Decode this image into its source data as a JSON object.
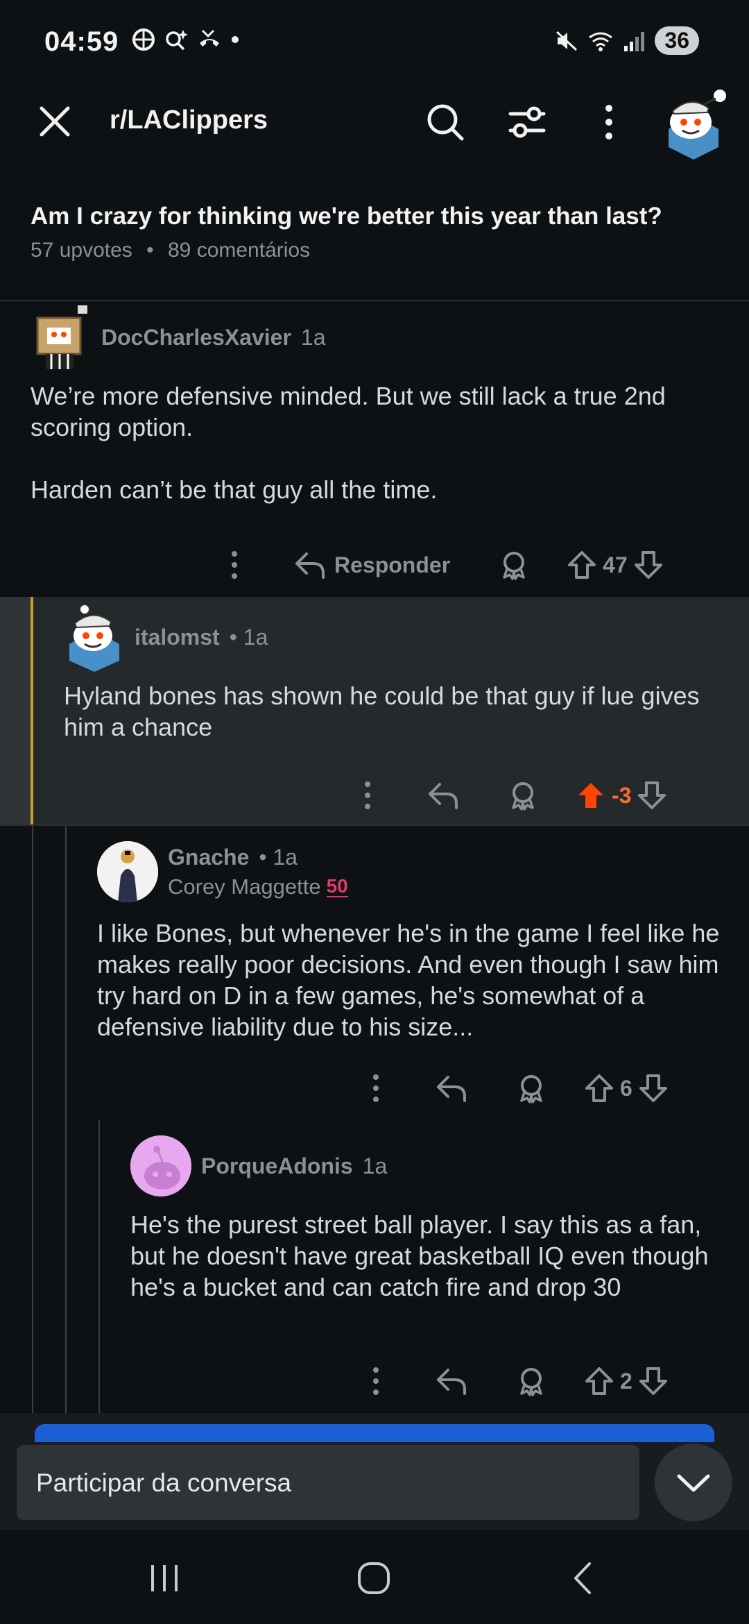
{
  "status_bar": {
    "time": "04:59",
    "battery": "36",
    "icons_left": [
      "basketball-icon",
      "sparkle-search-icon",
      "missed-call-icon",
      "dot-icon"
    ],
    "icons_right": [
      "mute-icon",
      "wifi-icon",
      "signal-icon"
    ]
  },
  "app_bar": {
    "subreddit": "r/LAClippers"
  },
  "post": {
    "title": "Am I crazy for thinking we're better this year than last?",
    "upvotes": "57 upvotes",
    "separator": "•",
    "comments": "89 comentários"
  },
  "comments": [
    {
      "user": "DocCharlesXavier",
      "age": "1a",
      "body": "We’re more defensive minded. But we still lack a true 2nd scoring option.\n\nHarden can’t be that guy all the time.",
      "reply_label": "Responder",
      "score": "47"
    },
    {
      "user": "italomst",
      "age": "• 1a",
      "body": "Hyland bones has shown he could be that guy if lue gives him a chance",
      "score": "-3"
    },
    {
      "user": "Gnache",
      "age": "• 1a",
      "flair": "Corey Maggette",
      "flair_badge": "50",
      "body": "I like Bones, but whenever he's in the game I feel like he makes really poor decisions. And even though I saw him try hard on D in a few games, he's somewhat of a defensive liability due to his size...",
      "score": "6"
    },
    {
      "user": "PorqueAdonis",
      "age": "1a",
      "body": "He's the purest street ball player. I say this as a fan, but he doesn't have great basketball IQ even though he's a bucket and can catch fire and drop 30",
      "score": "2"
    }
  ],
  "composer": {
    "placeholder": "Participar da conversa"
  },
  "colors": {
    "background": "#0e1113",
    "highlight": "#24292c",
    "upvote_active": "#ff4500",
    "accent_blue": "#1c5fd4",
    "highlight_bar": "#c9a227"
  }
}
